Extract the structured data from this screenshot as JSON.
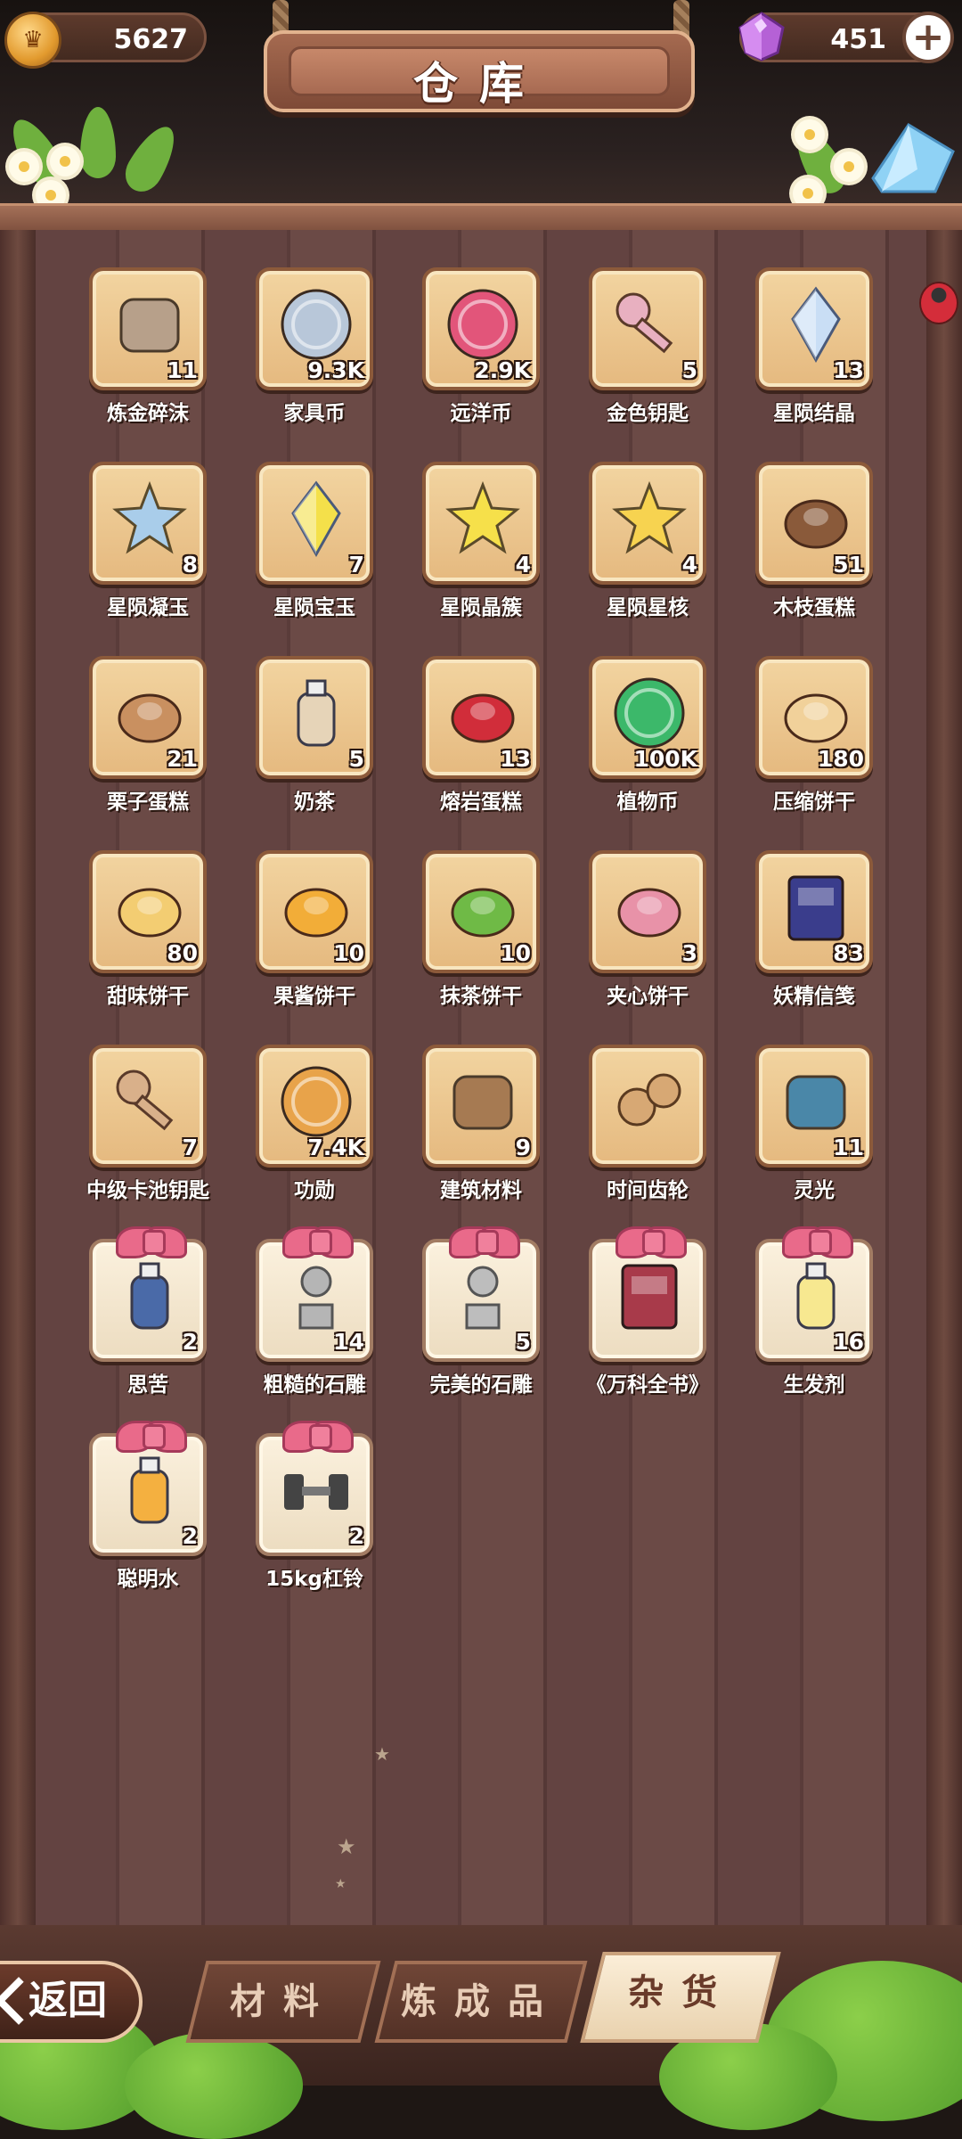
{
  "header": {
    "title": "仓库",
    "coins": "5627",
    "gems": "451"
  },
  "tabs": [
    {
      "label": "材料"
    },
    {
      "label": "炼成品"
    },
    {
      "label": "杂货",
      "active": true
    }
  ],
  "back_label": "返回",
  "items": [
    {
      "name": "炼金碎沫",
      "count": "11",
      "icon": "rubble-icon"
    },
    {
      "name": "家具币",
      "count": "9.3K",
      "icon": "furniture-coin-icon"
    },
    {
      "name": "远洋币",
      "count": "2.9K",
      "icon": "ocean-coin-icon"
    },
    {
      "name": "金色钥匙",
      "count": "5",
      "icon": "golden-key-icon"
    },
    {
      "name": "星陨结晶",
      "count": "13",
      "icon": "crystal-icon"
    },
    {
      "name": "星陨凝玉",
      "count": "8",
      "icon": "blue-star-gem-icon"
    },
    {
      "name": "星陨宝玉",
      "count": "7",
      "icon": "yellow-gem-icon"
    },
    {
      "name": "星陨晶簇",
      "count": "4",
      "icon": "yellow-star-gem-icon"
    },
    {
      "name": "星陨星核",
      "count": "4",
      "icon": "star-core-icon"
    },
    {
      "name": "木枝蛋糕",
      "count": "51",
      "icon": "log-cake-icon"
    },
    {
      "name": "栗子蛋糕",
      "count": "21",
      "icon": "chestnut-cake-icon"
    },
    {
      "name": "奶茶",
      "count": "5",
      "icon": "milk-tea-icon"
    },
    {
      "name": "熔岩蛋糕",
      "count": "13",
      "icon": "lava-cake-icon"
    },
    {
      "name": "植物币",
      "count": "100K",
      "icon": "plant-coin-icon"
    },
    {
      "name": "压缩饼干",
      "count": "180",
      "icon": "compressed-biscuit-icon"
    },
    {
      "name": "甜味饼干",
      "count": "80",
      "icon": "sweet-cracker-icon"
    },
    {
      "name": "果酱饼干",
      "count": "10",
      "icon": "jam-cookie-icon"
    },
    {
      "name": "抹茶饼干",
      "count": "10",
      "icon": "matcha-cookie-icon"
    },
    {
      "name": "夹心饼干",
      "count": "3",
      "icon": "sandwich-cookie-icon"
    },
    {
      "name": "妖精信笺",
      "count": "83",
      "icon": "fairy-letter-icon"
    },
    {
      "name": "中级卡池钥匙",
      "count": "7",
      "icon": "bronze-key-icon"
    },
    {
      "name": "功勋",
      "count": "7.4K",
      "icon": "medal-icon"
    },
    {
      "name": "建筑材料",
      "count": "9",
      "icon": "building-material-icon"
    },
    {
      "name": "时间齿轮",
      "count": "",
      "icon": "gears-icon"
    },
    {
      "name": "灵光",
      "count": "11",
      "icon": "inspiration-bulb-icon"
    },
    {
      "name": "思苦",
      "count": "2",
      "icon": "cup-icon",
      "gift": true
    },
    {
      "name": "粗糙的石雕",
      "count": "14",
      "icon": "rough-statue-icon",
      "gift": true
    },
    {
      "name": "完美的石雕",
      "count": "5",
      "icon": "perfect-statue-icon",
      "gift": true
    },
    {
      "name": "《万科全书》",
      "count": "",
      "icon": "book-icon",
      "gift": true
    },
    {
      "name": "生发剂",
      "count": "16",
      "icon": "potion-bottle-icon",
      "gift": true
    },
    {
      "name": "聪明水",
      "count": "2",
      "icon": "smart-water-icon",
      "gift": true
    },
    {
      "name": "15kg杠铃",
      "count": "2",
      "icon": "dumbbell-icon",
      "gift": true
    }
  ]
}
